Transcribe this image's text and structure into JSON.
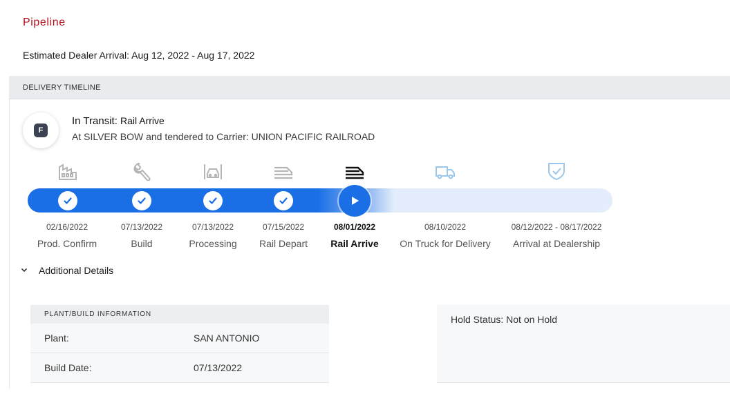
{
  "page": {
    "title": "Pipeline",
    "estimated_arrival": "Estimated Dealer Arrival: Aug 12, 2022 - Aug 17, 2022"
  },
  "timeline": {
    "header": "DELIVERY TIMELINE",
    "status_badge": "F",
    "status_prefix": "In Transit:",
    "status_stage": "Rail Arrive",
    "status_description": "At SILVER BOW and tendered to Carrier: UNION PACIFIC RAILROAD",
    "stages": [
      {
        "label": "Prod. Confirm",
        "date": "02/16/2022",
        "icon": "factory-icon",
        "state": "complete"
      },
      {
        "label": "Build",
        "date": "07/13/2022",
        "icon": "wrench-icon",
        "state": "complete"
      },
      {
        "label": "Processing",
        "date": "07/13/2022",
        "icon": "vehicle-processing-icon",
        "state": "complete"
      },
      {
        "label": "Rail Depart",
        "date": "07/15/2022",
        "icon": "rail-car-icon",
        "state": "complete"
      },
      {
        "label": "Rail Arrive",
        "date": "08/01/2022",
        "icon": "rail-car-icon",
        "state": "current"
      },
      {
        "label": "On Truck for Delivery",
        "date": "08/10/2022",
        "icon": "truck-icon",
        "state": "upcoming"
      },
      {
        "label": "Arrival at Dealership",
        "date": "08/12/2022 - 08/17/2022",
        "icon": "shield-check-icon",
        "state": "upcoming"
      }
    ],
    "colors": {
      "progress": "#1a6fe6",
      "track": "#e3edfb",
      "title_red": "#b3121c",
      "upcoming_icon": "#9cc7ea",
      "completed_icon": "#b5b5b5"
    }
  },
  "details": {
    "toggle_label": "Additional Details",
    "plant_panel": {
      "header": "PLANT/BUILD INFORMATION",
      "rows": [
        {
          "key": "Plant:",
          "value": "SAN ANTONIO"
        },
        {
          "key": "Build Date:",
          "value": "07/13/2022"
        }
      ]
    },
    "hold_status": "Hold Status: Not on Hold"
  }
}
